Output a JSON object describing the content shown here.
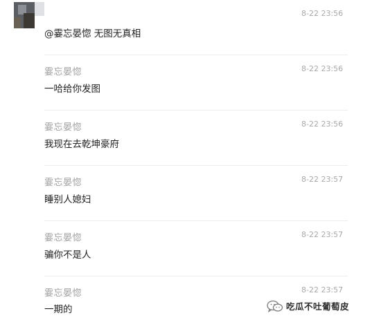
{
  "replies": [
    {
      "author": "",
      "content_prefix": "@霎忘晏惚",
      "content": " 无图无真相",
      "time": "8-22 23:56"
    },
    {
      "author": "霎忘晏惚",
      "content": "一哈给你发图",
      "time": "8-22 23:56"
    },
    {
      "author": "霎忘晏惚",
      "content": "我现在去乾坤豪府",
      "time": "8-22 23:56"
    },
    {
      "author": "霎忘晏惚",
      "content": "睡别人媳妇",
      "time": "8-22 23:57"
    },
    {
      "author": "霎忘晏惚",
      "content": "骗你不是人",
      "time": "8-22 23:57"
    },
    {
      "author": "霎忘晏惚",
      "content": "一期的",
      "time": "8-22 23:57"
    }
  ],
  "watermark": {
    "text": "吃瓜不吐葡萄皮",
    "icon": "wechat-icon"
  },
  "colors": {
    "author": "#a0a0a0",
    "content": "#222222",
    "time": "#a8a8a8",
    "divider": "#ececec"
  }
}
